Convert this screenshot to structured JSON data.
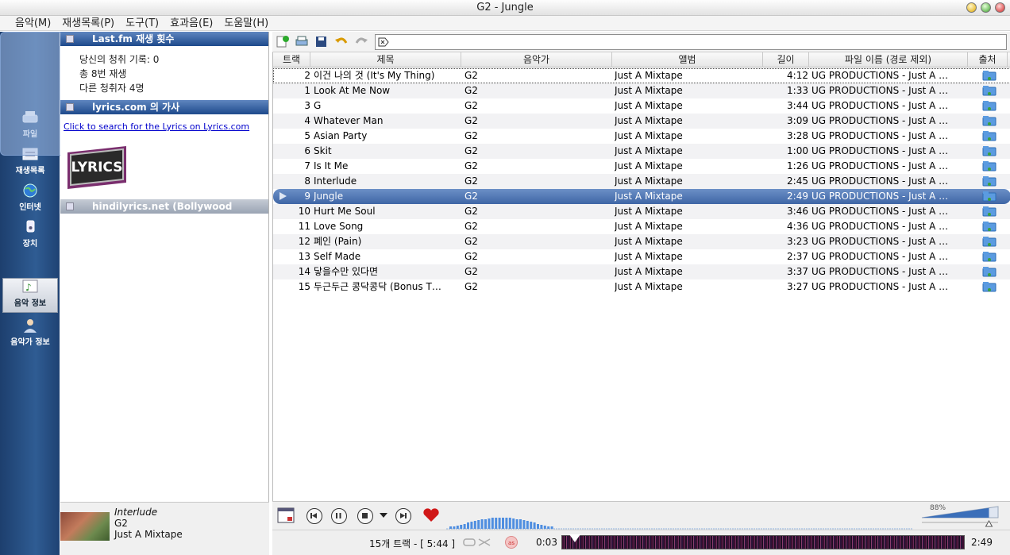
{
  "window": {
    "title": "G2 - Jungle"
  },
  "menu": [
    "음악(M)",
    "재생목록(P)",
    "도구(T)",
    "효과음(E)",
    "도움말(H)"
  ],
  "nav": {
    "file": "파일",
    "playlist": "재생목록",
    "internet": "인터넷",
    "device": "장치",
    "music_info": "음악 정보",
    "artist_info": "음악가 정보"
  },
  "lastfm": {
    "header": "Last.fm 재생 횟수",
    "lines": [
      "당신의 청취 기록: 0",
      "총 8번 재생",
      "다른 청취자 4명"
    ]
  },
  "lyrics": {
    "header": "lyrics.com 의 가사",
    "link": "Click to search for the Lyrics on Lyrics.com",
    "logo_text": "LYRICS"
  },
  "hindi": {
    "header": "hindilyrics.net (Bollywood songs)"
  },
  "now_playing": {
    "title": "Interlude",
    "artist": "G2",
    "album": "Just A Mixtape"
  },
  "columns": {
    "track": "트랙",
    "title": "제목",
    "artist": "음악가",
    "album": "앨범",
    "length": "길이",
    "file": "파일 이름 (경로 제외)",
    "source": "출처"
  },
  "tracks": [
    {
      "n": "2",
      "title": "이건 나의 것 (It's My Thing)",
      "artist": "G2",
      "album": "Just A Mixtape",
      "len": "4:12",
      "file": "UG PRODUCTIONS - Just A …"
    },
    {
      "n": "1",
      "title": "Look At Me Now",
      "artist": "G2",
      "album": "Just A Mixtape",
      "len": "1:33",
      "file": "UG PRODUCTIONS - Just A …"
    },
    {
      "n": "3",
      "title": "G",
      "artist": "G2",
      "album": "Just A Mixtape",
      "len": "3:44",
      "file": "UG PRODUCTIONS - Just A …"
    },
    {
      "n": "4",
      "title": "Whatever Man",
      "artist": "G2",
      "album": "Just A Mixtape",
      "len": "3:09",
      "file": "UG PRODUCTIONS - Just A …"
    },
    {
      "n": "5",
      "title": "Asian Party",
      "artist": "G2",
      "album": "Just A Mixtape",
      "len": "3:28",
      "file": "UG PRODUCTIONS - Just A …"
    },
    {
      "n": "6",
      "title": "Skit",
      "artist": "G2",
      "album": "Just A Mixtape",
      "len": "1:00",
      "file": "UG PRODUCTIONS - Just A …"
    },
    {
      "n": "7",
      "title": "Is It Me",
      "artist": "G2",
      "album": "Just A Mixtape",
      "len": "1:26",
      "file": "UG PRODUCTIONS - Just A …"
    },
    {
      "n": "8",
      "title": "Interlude",
      "artist": "G2",
      "album": "Just A Mixtape",
      "len": "2:45",
      "file": "UG PRODUCTIONS - Just A …"
    },
    {
      "n": "9",
      "title": "Jungle",
      "artist": "G2",
      "album": "Just A Mixtape",
      "len": "2:49",
      "file": "UG PRODUCTIONS - Just A …",
      "playing": true
    },
    {
      "n": "10",
      "title": "Hurt Me Soul",
      "artist": "G2",
      "album": "Just A Mixtape",
      "len": "3:46",
      "file": "UG PRODUCTIONS - Just A …"
    },
    {
      "n": "11",
      "title": "Love Song",
      "artist": "G2",
      "album": "Just A Mixtape",
      "len": "4:36",
      "file": "UG PRODUCTIONS - Just A …"
    },
    {
      "n": "12",
      "title": "폐인 (Pain)",
      "artist": "G2",
      "album": "Just A Mixtape",
      "len": "3:23",
      "file": "UG PRODUCTIONS - Just A …"
    },
    {
      "n": "13",
      "title": "Self Made",
      "artist": "G2",
      "album": "Just A Mixtape",
      "len": "2:37",
      "file": "UG PRODUCTIONS - Just A …"
    },
    {
      "n": "14",
      "title": "닿을수만 있다면",
      "artist": "G2",
      "album": "Just A Mixtape",
      "len": "3:37",
      "file": "UG PRODUCTIONS - Just A …"
    },
    {
      "n": "15",
      "title": "두근두근 콩닥콩닥 (Bonus T…",
      "artist": "G2",
      "album": "Just A Mixtape",
      "len": "3:27",
      "file": "UG PRODUCTIONS - Just A …"
    }
  ],
  "status": {
    "summary": "15개 트랙 - [ 5:44 ]",
    "elapsed": "0:03",
    "total": "2:49",
    "volume_label": "88%",
    "volume_level": 0.88,
    "seek_fraction": 0.018
  },
  "colors": {
    "accent": "#2f5c93",
    "selection": "#4a6fad"
  }
}
